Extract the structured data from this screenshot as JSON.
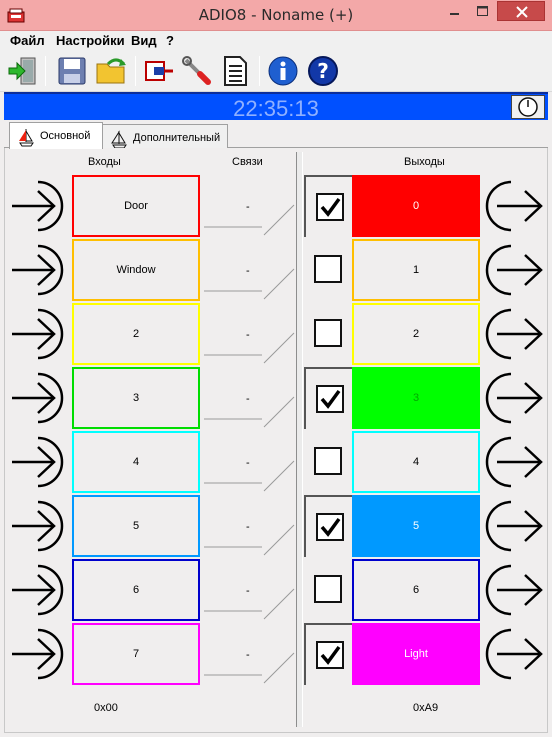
{
  "window": {
    "title": "ADIO8 - Noname (+)"
  },
  "menu": [
    "Файл",
    "Настройки",
    "Вид",
    "?"
  ],
  "toolbar": {
    "items": [
      "exit-icon",
      "save-icon",
      "open-folder-icon",
      "connect-icon",
      "tools-icon",
      "document-icon",
      "info-icon",
      "help-icon"
    ]
  },
  "clock": {
    "time": "22:35:13"
  },
  "tabs": [
    {
      "label": "Основной",
      "active": true
    },
    {
      "label": "Дополнительный",
      "active": false
    }
  ],
  "headers": {
    "inputs": "Входы",
    "links": "Связи",
    "outputs": "Выходы"
  },
  "inputs": [
    {
      "label": "Door",
      "color": "#ff0000"
    },
    {
      "label": "Window",
      "color": "#ffbf00"
    },
    {
      "label": "2",
      "color": "#ffff00"
    },
    {
      "label": "3",
      "color": "#00dd00"
    },
    {
      "label": "4",
      "color": "#00ffff"
    },
    {
      "label": "5",
      "color": "#0099ff"
    },
    {
      "label": "6",
      "color": "#0000cc"
    },
    {
      "label": "7",
      "color": "#ff00ff"
    }
  ],
  "links": [
    "-",
    "-",
    "-",
    "-",
    "-",
    "-",
    "-",
    "-"
  ],
  "outputs": [
    {
      "label": "0",
      "checked": true,
      "border": "#ff0000",
      "fill": "#ff0000",
      "text_color": "#ffffff"
    },
    {
      "label": "1",
      "checked": false,
      "border": "#ffbf00",
      "fill": "#f0eeee",
      "text_color": "#000000"
    },
    {
      "label": "2",
      "checked": false,
      "border": "#ffff00",
      "fill": "#f0eeee",
      "text_color": "#000000"
    },
    {
      "label": "3",
      "checked": true,
      "border": "#00ff00",
      "fill": "#00ff00",
      "text_color": "#00aa00"
    },
    {
      "label": "4",
      "checked": false,
      "border": "#00ffff",
      "fill": "#f0eeee",
      "text_color": "#000000"
    },
    {
      "label": "5",
      "checked": true,
      "border": "#0099ff",
      "fill": "#0099ff",
      "text_color": "#ffffff"
    },
    {
      "label": "6",
      "checked": false,
      "border": "#0000cc",
      "fill": "#f0eeee",
      "text_color": "#000000"
    },
    {
      "label": "Light",
      "checked": true,
      "border": "#ff00ff",
      "fill": "#ff00ff",
      "text_color": "#ffffff"
    }
  ],
  "footer": {
    "inputs_hex": "0x00",
    "outputs_hex": "0xA9"
  }
}
